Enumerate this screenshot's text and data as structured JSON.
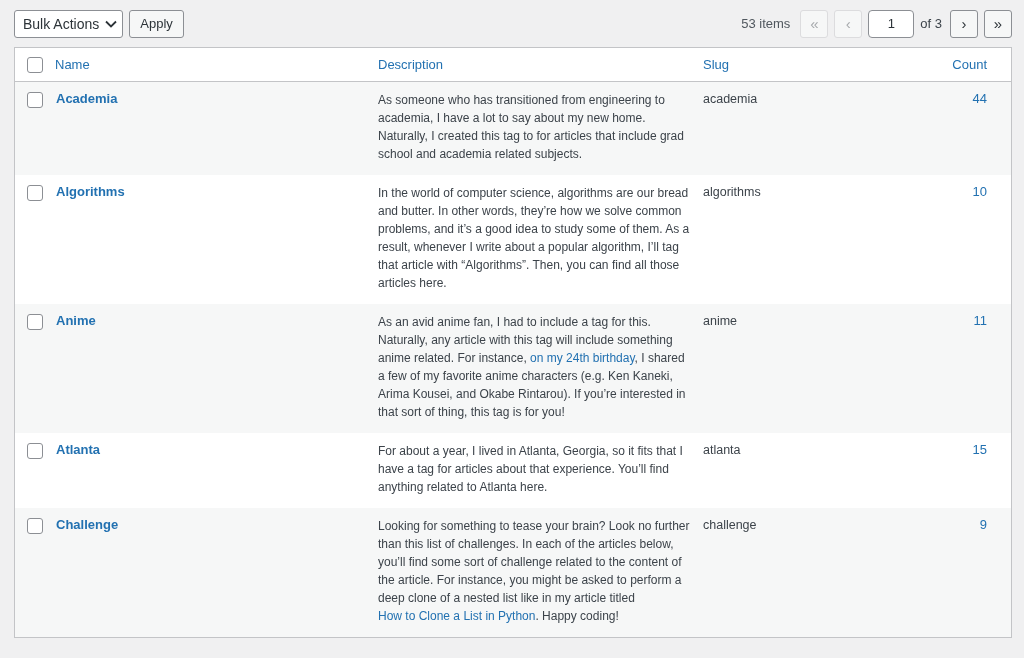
{
  "toolbar": {
    "bulk_actions": "Bulk Actions",
    "apply": "Apply",
    "items_count": "53 items",
    "pagination": {
      "first": {
        "label": "«",
        "disabled": true
      },
      "prev": {
        "label": "‹",
        "disabled": true
      },
      "current_page": "1",
      "of_pages": "of 3",
      "next": {
        "label": "›",
        "disabled": false
      },
      "last": {
        "label": "»",
        "disabled": false
      }
    }
  },
  "table": {
    "select_all_checked": false,
    "columns": [
      "Name",
      "Description",
      "Slug",
      "Count"
    ],
    "rows": [
      {
        "name": "Academia",
        "checked": false,
        "description": [
          {
            "kind": "text",
            "text": "As someone who has transitioned from engineering to academia, I have a lot to say about my new home. Naturally, I created this tag to for articles that include grad school and academia related subjects."
          }
        ],
        "slug": "academia",
        "count": "44"
      },
      {
        "name": "Algorithms",
        "checked": false,
        "description": [
          {
            "kind": "text",
            "text": "In the world of computer science, algorithms are our bread and butter. In other words, they’re how we solve common problems, and it’s a good idea to study some of them. As a result, whenever I write about a popular algorithm, I’ll tag that article with “Algorithms”. Then, you can find all those articles here."
          }
        ],
        "slug": "algorithms",
        "count": "10"
      },
      {
        "name": "Anime",
        "checked": false,
        "description": [
          {
            "kind": "text",
            "text": "As an avid anime fan, I had to include a tag for this. Naturally, any article with this tag will include something anime related. For instance, "
          },
          {
            "kind": "link",
            "text": "on my 24th birthday"
          },
          {
            "kind": "text",
            "text": ", I shared a few of my favorite anime characters (e.g. Ken Kaneki, Arima Kousei, and Okabe Rintarou). If you’re interested in that sort of thing, this tag is for you!"
          }
        ],
        "slug": "anime",
        "count": "11"
      },
      {
        "name": "Atlanta",
        "checked": false,
        "description": [
          {
            "kind": "text",
            "text": "For about a year, I lived in Atlanta, Georgia, so it fits that I have a tag for articles about that experience. You’ll find anything related to Atlanta here."
          }
        ],
        "slug": "atlanta",
        "count": "15"
      },
      {
        "name": "Challenge",
        "checked": false,
        "description": [
          {
            "kind": "text",
            "text": "Looking for something to tease your brain? Look no further than this list of challenges. In each of the articles below, you’ll find some sort of challenge related to the content of the article. For instance, you might be asked to perform a deep clone of a nested list like in my article titled "
          },
          {
            "kind": "link",
            "text": "How to Clone a List in Python"
          },
          {
            "kind": "text",
            "text": ". Happy coding!"
          }
        ],
        "slug": "challenge",
        "count": "9"
      }
    ]
  }
}
